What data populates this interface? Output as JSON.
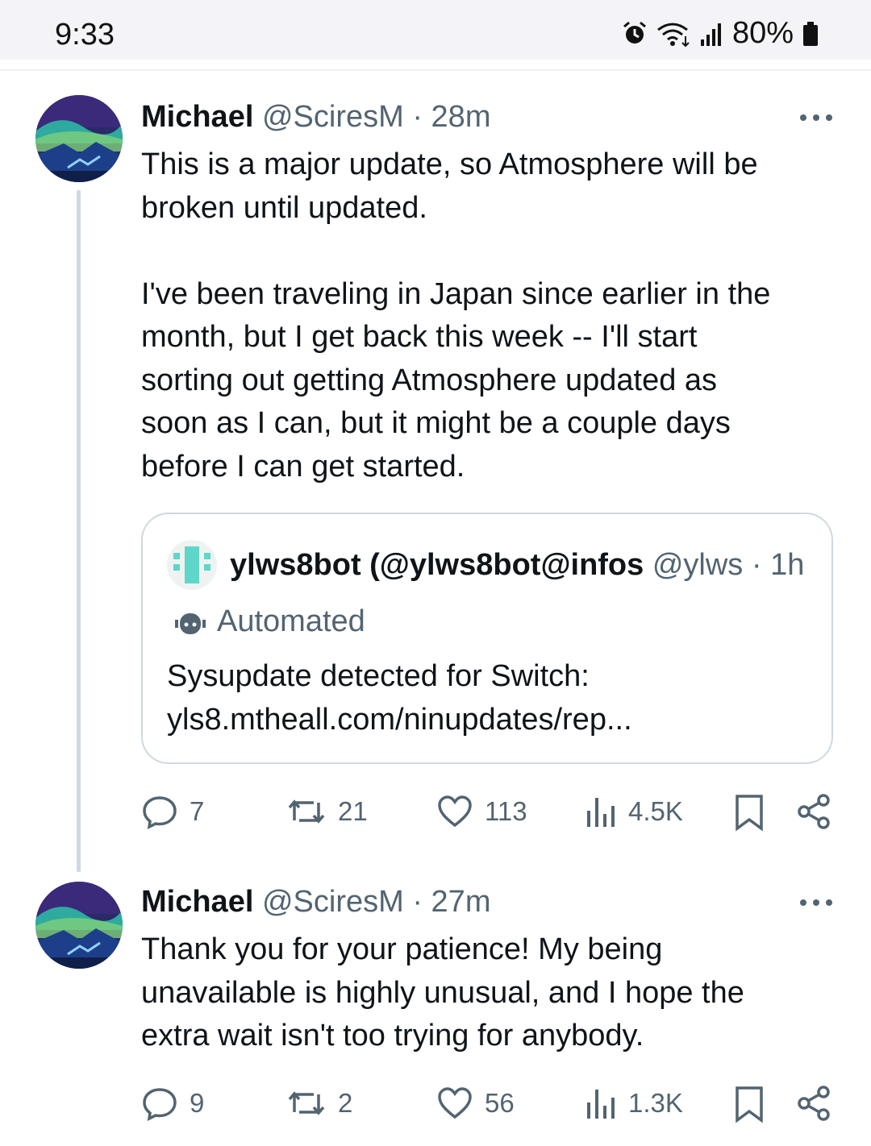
{
  "status_bar": {
    "time": "9:33",
    "battery": "80%"
  },
  "colors": {
    "text": "#0f1419",
    "muted": "#536471",
    "border": "#cfd9de"
  },
  "tweets": [
    {
      "name": "Michael",
      "handle": "@SciresM",
      "separator": " · ",
      "time": "28m",
      "text": "This is a major update, so Atmosphere will be\nbroken until updated.\n\nI've been traveling in Japan since earlier in the\nmonth, but I get back this week -- I'll start\nsorting out getting Atmosphere updated as\nsoon as I can, but it might be a couple days\nbefore I can get started.",
      "quote": {
        "name": "ylws8bot (@ylws8bot@infos",
        "handle": "@ylws",
        "separator": " · ",
        "time": "1h",
        "label": "Automated",
        "text": "Sysupdate detected for Switch:\nyls8.mtheall.com/ninupdates/rep..."
      },
      "stats": {
        "replies": "7",
        "reposts": "21",
        "likes": "113",
        "views": "4.5K"
      }
    },
    {
      "name": "Michael",
      "handle": "@SciresM",
      "separator": " · ",
      "time": "27m",
      "text": "Thank you for your patience! My being\nunavailable is highly unusual, and I hope the\nextra wait isn't too trying for anybody.",
      "stats": {
        "replies": "9",
        "reposts": "2",
        "likes": "56",
        "views": "1.3K"
      }
    }
  ],
  "icons": [
    "alarm-icon",
    "wifi-icon",
    "signal-icon",
    "battery-icon",
    "more-icon",
    "reply-icon",
    "repost-icon",
    "like-icon",
    "views-icon",
    "bookmark-icon",
    "share-icon",
    "robot-icon"
  ]
}
